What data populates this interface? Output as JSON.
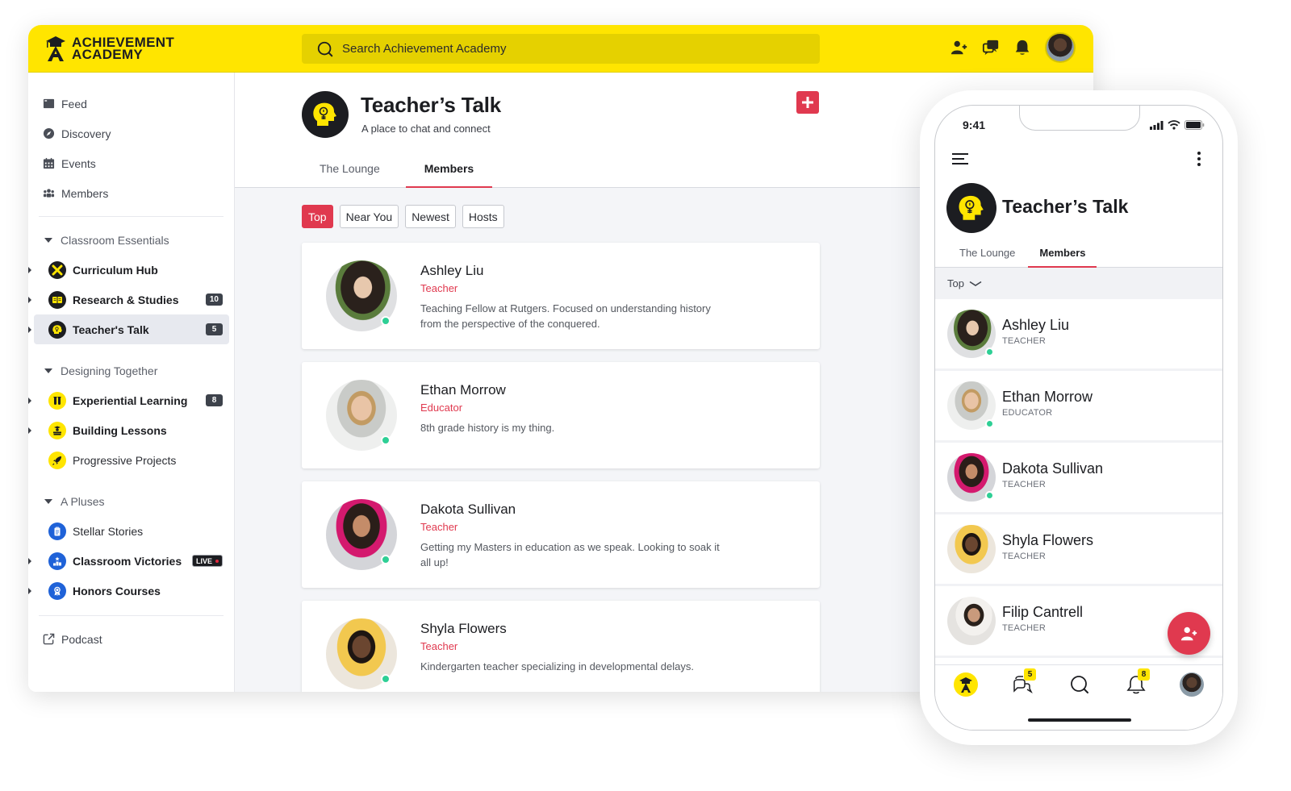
{
  "app": {
    "brand_line1": "Achievement",
    "brand_line2": "Academy",
    "search_placeholder": "Search Achievement Academy",
    "colors": {
      "brand_yellow": "#ffe500",
      "accent_red": "#e0394f",
      "online_green": "#2ecf95",
      "sidebar_active": "#e7e9ef"
    }
  },
  "topbar": {
    "icons": [
      "add-friend-icon",
      "chat-bubbles-icon",
      "bell-icon",
      "user-avatar"
    ]
  },
  "sidebar": {
    "nav": [
      {
        "label": "Feed",
        "icon": "feed-icon"
      },
      {
        "label": "Discovery",
        "icon": "compass-icon"
      },
      {
        "label": "Events",
        "icon": "calendar-icon"
      },
      {
        "label": "Members",
        "icon": "members-icon"
      }
    ],
    "groups": [
      {
        "label": "Classroom Essentials",
        "spaces": [
          {
            "label": "Curriculum Hub",
            "icon": "pencil-cross-icon"
          },
          {
            "label": "Research & Studies",
            "icon": "book-icon",
            "badge": "10"
          },
          {
            "label": "Teacher's Talk",
            "icon": "lightbulb-head-icon",
            "badge": "5",
            "active": true
          }
        ]
      },
      {
        "label": "Designing Together",
        "spaces": [
          {
            "label": "Experiential Learning",
            "icon": "test-tubes-icon",
            "badge": "8"
          },
          {
            "label": "Building Lessons",
            "icon": "graduate-books-icon"
          },
          {
            "label": "Progressive Projects",
            "icon": "rocket-icon"
          }
        ]
      },
      {
        "label": "A Pluses",
        "spaces": [
          {
            "label": "Stellar Stories",
            "icon": "clipboard-icon"
          },
          {
            "label": "Classroom Victories",
            "icon": "podium-icon",
            "badge": "LIVE"
          },
          {
            "label": "Honors Courses",
            "icon": "award-ribbon-icon"
          }
        ]
      }
    ],
    "footer_link": {
      "label": "Podcast",
      "icon": "external-link-icon"
    }
  },
  "group": {
    "title": "Teacher’s Talk",
    "subtitle": "A place to chat and connect",
    "tabs": [
      {
        "label": "The Lounge"
      },
      {
        "label": "Members",
        "active": true
      }
    ],
    "filters": [
      {
        "label": "Top",
        "active": true
      },
      {
        "label": "Near You"
      },
      {
        "label": "Newest"
      },
      {
        "label": "Hosts"
      }
    ]
  },
  "members": [
    {
      "name": "Ashley Liu",
      "role": "Teacher",
      "bio": "Teaching Fellow at Rutgers. Focused on understanding history from the perspective of the conquered.",
      "online": true
    },
    {
      "name": "Ethan Morrow",
      "role": "Educator",
      "bio": "8th grade history is my thing.",
      "online": true
    },
    {
      "name": "Dakota Sullivan",
      "role": "Teacher",
      "bio": "Getting my Masters in education as we speak. Looking to soak it all up!",
      "online": true
    },
    {
      "name": "Shyla Flowers",
      "role": "Teacher",
      "bio": "Kindergarten teacher specializing in developmental delays.",
      "online": true
    }
  ],
  "phone": {
    "time": "9:41",
    "title": "Teacher’s Talk",
    "tabs": [
      {
        "label": "The Lounge"
      },
      {
        "label": "Members",
        "active": true
      }
    ],
    "sort_label": "Top",
    "members": [
      {
        "name": "Ashley Liu",
        "role": "TEACHER",
        "online": true
      },
      {
        "name": "Ethan Morrow",
        "role": "EDUCATOR",
        "online": true
      },
      {
        "name": "Dakota Sullivan",
        "role": "TEACHER",
        "online": true
      },
      {
        "name": "Shyla Flowers",
        "role": "TEACHER",
        "online": false
      },
      {
        "name": "Filip Cantrell",
        "role": "TEACHER",
        "online": false
      }
    ],
    "bottom_nav": [
      {
        "icon": "home-logo-icon"
      },
      {
        "icon": "chat-icon",
        "count": "5"
      },
      {
        "icon": "search-icon"
      },
      {
        "icon": "bell-icon",
        "count": "8"
      },
      {
        "icon": "profile-avatar"
      }
    ]
  }
}
